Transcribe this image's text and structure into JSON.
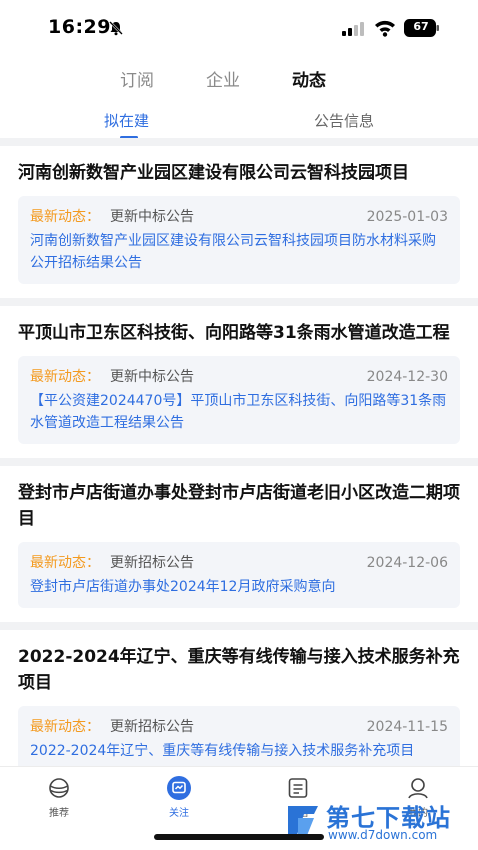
{
  "status_bar": {
    "time": "16:29",
    "battery": "67"
  },
  "top_tabs": {
    "subscribe": "订阅",
    "company": "企业",
    "dynamics": "动态"
  },
  "sub_tabs": {
    "planned": "拟在建",
    "notice": "公告信息"
  },
  "projects": [
    {
      "title": "河南创新数智产业园区建设有限公司云智科技园项目",
      "label": "最新动态：",
      "type": "更新中标公告",
      "date": "2025-01-03",
      "desc": "河南创新数智产业园区建设有限公司云智科技园项目防水材料采购公开招标结果公告"
    },
    {
      "title": "平顶山市卫东区科技街、向阳路等31条雨水管道改造工程",
      "label": "最新动态：",
      "type": "更新中标公告",
      "date": "2024-12-30",
      "desc": "【平公资建2024470号】平顶山市卫东区科技街、向阳路等31条雨水管道改造工程结果公告"
    },
    {
      "title": "登封市卢店街道办事处登封市卢店街道老旧小区改造二期项目",
      "label": "最新动态：",
      "type": "更新招标公告",
      "date": "2024-12-06",
      "desc": "登封市卢店街道办事处2024年12月政府采购意向"
    },
    {
      "title": "2022-2024年辽宁、重庆等有线传输与接入技术服务补充项目",
      "label": "最新动态：",
      "type": "更新招标公告",
      "date": "2024-11-15",
      "desc": "2022-2024年辽宁、重庆等有线传输与接入技术服务补充项目"
    }
  ],
  "bottom_nav": {
    "recommend": "推荐",
    "follow": "关注",
    "data": "数据",
    "mine": "我的"
  },
  "watermark": {
    "title": "第七下载站",
    "url": "www.d7down.com"
  },
  "colors": {
    "accent": "#2f6ee0",
    "label_orange": "#f39a1f",
    "box_bg": "#f3f5f9"
  }
}
